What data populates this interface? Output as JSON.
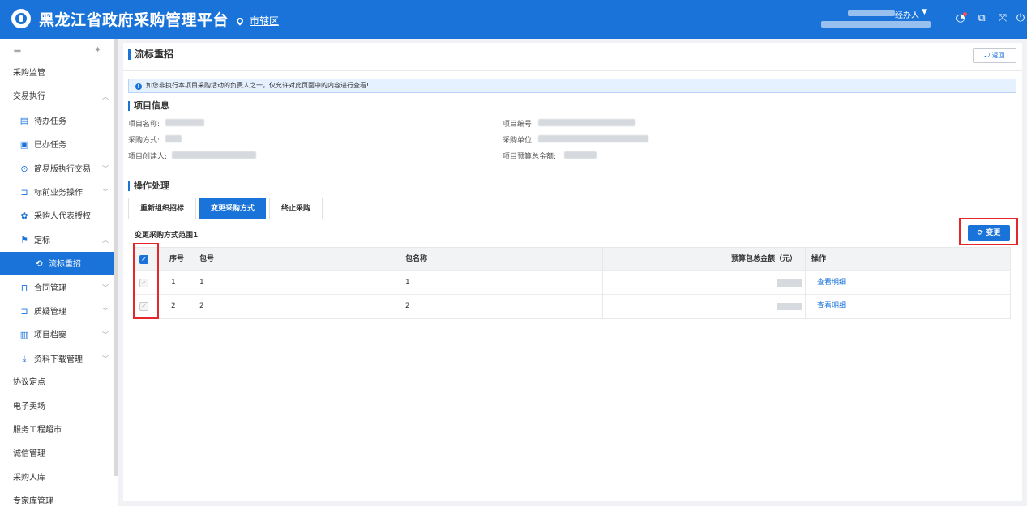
{
  "header": {
    "app_title": "黑龙江省政府采购管理平台",
    "region": "市辖区",
    "user_role": "经办人",
    "caret": "▼",
    "icons": [
      "bell-icon",
      "message-icon",
      "fullscreen-icon",
      "power-icon"
    ]
  },
  "sidebar": {
    "items": [
      {
        "label": "采购监管",
        "level": 0
      },
      {
        "label": "交易执行",
        "level": 0,
        "arrow": "︿"
      },
      {
        "label": "待办任务",
        "level": 1,
        "icon": "todo-icon"
      },
      {
        "label": "已办任务",
        "level": 1,
        "icon": "done-icon"
      },
      {
        "label": "简易版执行交易",
        "level": 1,
        "icon": "play-icon",
        "arrow": "﹀"
      },
      {
        "label": "标前业务操作",
        "level": 1,
        "icon": "cart-icon",
        "arrow": "﹀"
      },
      {
        "label": "采购人代表授权",
        "level": 1,
        "icon": "settings-icon"
      },
      {
        "label": "定标",
        "level": 1,
        "icon": "award-icon",
        "arrow": "︿"
      },
      {
        "label": "流标重招",
        "level": 2,
        "icon": "refresh-icon",
        "active": true
      },
      {
        "label": "合同管理",
        "level": 1,
        "icon": "lock-icon",
        "arrow": "﹀"
      },
      {
        "label": "质疑管理",
        "level": 1,
        "icon": "cart-icon",
        "arrow": "﹀"
      },
      {
        "label": "项目档案",
        "level": 1,
        "icon": "archive-icon",
        "arrow": "﹀"
      },
      {
        "label": "资料下载管理",
        "level": 1,
        "icon": "download-icon",
        "arrow": "﹀"
      },
      {
        "label": "协议定点",
        "level": 0
      },
      {
        "label": "电子卖场",
        "level": 0
      },
      {
        "label": "服务工程超市",
        "level": 0
      },
      {
        "label": "诚信管理",
        "level": 0
      },
      {
        "label": "采购人库",
        "level": 0
      },
      {
        "label": "专家库管理",
        "level": 0
      }
    ]
  },
  "page": {
    "title": "流标重招",
    "back_label": "返回",
    "notice": "如您非执行本项目采购活动的负责人之一，仅允许对此页面中的内容进行查看!"
  },
  "project_info": {
    "section_title": "项目信息",
    "name_label": "项目名称:",
    "code_label": "项目编号",
    "method_label": "采购方式:",
    "unit_label": "采购单位:",
    "creator_label": "项目创建人:",
    "budget_label": "项目预算总金额:"
  },
  "operations": {
    "section_title": "操作处理",
    "tabs": [
      "重新组织招标",
      "变更采购方式",
      "终止采购"
    ],
    "active_tab": 1,
    "range_label": "变更采购方式范围1",
    "change_button": "变更"
  },
  "table": {
    "headers": {
      "index": "序号",
      "package": "包号",
      "package_name": "包名称",
      "budget": "预算包总金额（元）",
      "action": "操作"
    },
    "rows": [
      {
        "index": "1",
        "package": "1",
        "package_name": "1",
        "action": "查看明细"
      },
      {
        "index": "2",
        "package": "2",
        "package_name": "2",
        "action": "查看明细"
      }
    ]
  },
  "colors": {
    "primary": "#1a73d9",
    "highlight": "#e5262b"
  }
}
